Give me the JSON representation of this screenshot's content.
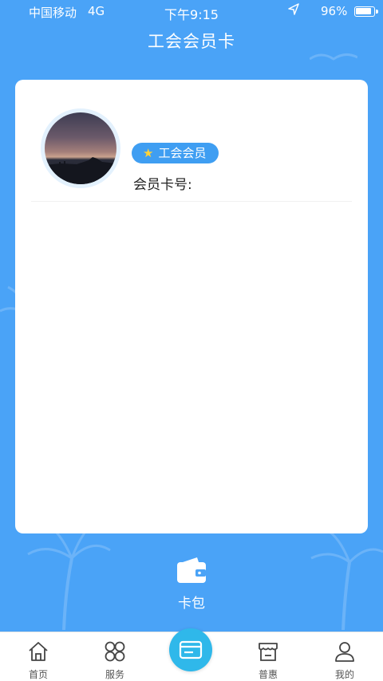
{
  "status_bar": {
    "carrier": "中国移动",
    "network": "4G",
    "time": "下午9:15",
    "battery_percent": "96%",
    "battery_level": 0.96
  },
  "header": {
    "title": "工会会员卡"
  },
  "card": {
    "badge_label": "工会会员",
    "card_number_label": "会员卡号:",
    "card_number_value": ""
  },
  "wallet": {
    "label": "卡包",
    "icon": "wallet-icon"
  },
  "tabbar": {
    "items": [
      {
        "label": "首页",
        "icon": "home-icon"
      },
      {
        "label": "服务",
        "icon": "grid-icon"
      },
      {
        "label": "",
        "icon": "card-icon"
      },
      {
        "label": "普惠",
        "icon": "store-icon"
      },
      {
        "label": "我的",
        "icon": "user-icon"
      }
    ]
  },
  "colors": {
    "background": "#4aa3f7",
    "badge": "#3f9ef2",
    "center_button": "#2fb8ea"
  }
}
